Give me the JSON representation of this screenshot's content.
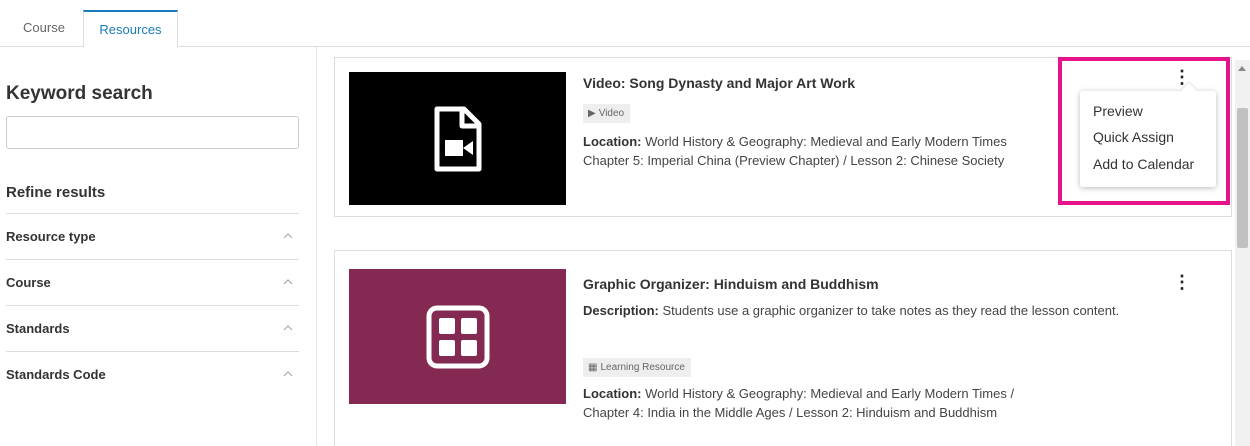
{
  "tabs": {
    "course": "Course",
    "resources": "Resources"
  },
  "sidebar": {
    "keyword_title": "Keyword search",
    "keyword_value": "",
    "refine_title": "Refine results",
    "filters": [
      "Resource type",
      "Course",
      "Standards",
      "Standards Code"
    ]
  },
  "resources": [
    {
      "title": "Video: Song Dynasty and Major Art Work",
      "badge": "Video",
      "location_label": "Location:",
      "location_line1": "World History & Geography: Medieval and Early Modern Times",
      "location_line2": "Chapter 5: Imperial China (Preview Chapter) / Lesson 2: Chinese Society"
    },
    {
      "title": "Graphic Organizer: Hinduism and Buddhism",
      "description_label": "Description:",
      "description": "Students use a graphic organizer to take notes as they read the lesson content.",
      "badge": "Learning Resource",
      "location_label": "Location:",
      "location_line1": "World History & Geography: Medieval and Early Modern Times /",
      "location_line2": "Chapter 4: India in the Middle Ages / Lesson 2: Hinduism and Buddhism"
    }
  ],
  "menu": {
    "items": [
      "Preview",
      "Quick Assign",
      "Add to Calendar"
    ]
  },
  "colors": {
    "accent": "#1a7bb9",
    "highlight": "#e6128c",
    "organizer_thumb": "#842a52"
  }
}
